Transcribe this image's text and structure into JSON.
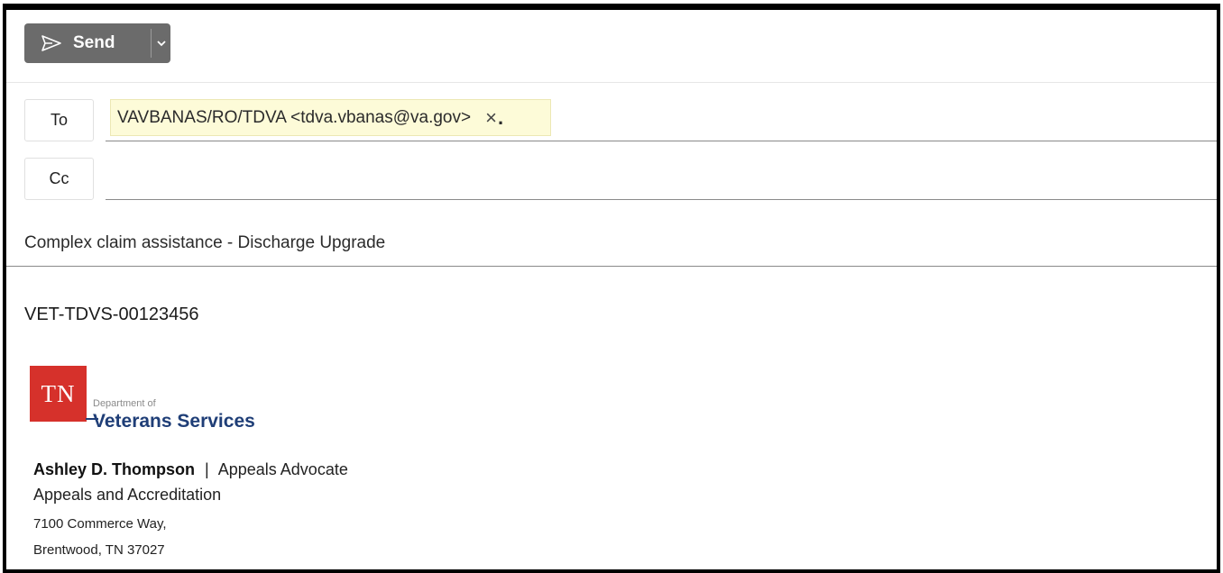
{
  "toolbar": {
    "send_label": "Send",
    "send_icon": "paper-plane-icon",
    "dropdown_icon": "chevron-down-icon",
    "button_color": "#6b6b6b"
  },
  "recipients": {
    "to_label": "To",
    "to_chip": "VAVBANAS/RO/TDVA <tdva.vbanas@va.gov>",
    "remove_symbol": "×",
    "cc_label": "Cc"
  },
  "subject": "Complex claim assistance - Discharge Upgrade",
  "body": {
    "reference_id": "VET-TDVS-00123456"
  },
  "signature": {
    "logo": {
      "initials": "TN",
      "department_of": "Department of",
      "org_name": "Veterans Services",
      "red": "#d6312b",
      "blue": "#1f3e77"
    },
    "name": "Ashley D. Thompson",
    "separator": "|",
    "title": "Appeals Advocate",
    "division": "Appeals and Accreditation",
    "address_line1": "7100 Commerce Way,",
    "address_line2": "Brentwood, TN 37027"
  }
}
